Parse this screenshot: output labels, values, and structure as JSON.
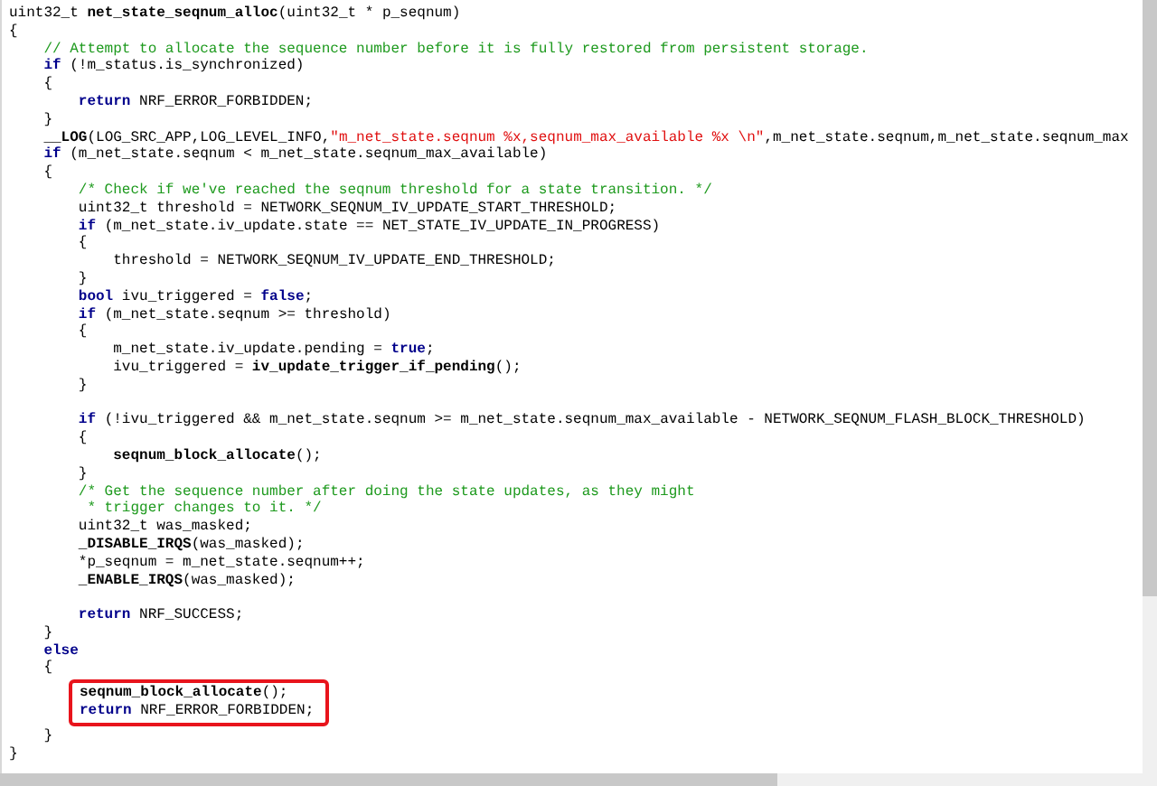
{
  "editor": {
    "lines": [
      {
        "kind": "code",
        "tokens": [
          {
            "kind": "plain",
            "text": "uint32_t "
          },
          {
            "kind": "function",
            "text": "net_state_seqnum_alloc"
          },
          {
            "kind": "plain",
            "text": "(uint32_t * p_seqnum)"
          }
        ]
      },
      {
        "kind": "code",
        "tokens": [
          {
            "kind": "plain",
            "text": "{"
          }
        ]
      },
      {
        "kind": "code",
        "tokens": [
          {
            "kind": "comment",
            "text": "    // Attempt to allocate the sequence number before it is fully restored from persistent storage."
          }
        ]
      },
      {
        "kind": "code",
        "tokens": [
          {
            "kind": "keyword",
            "text": "    if"
          },
          {
            "kind": "plain",
            "text": " (!m_status.is_synchronized)"
          }
        ]
      },
      {
        "kind": "code",
        "tokens": [
          {
            "kind": "plain",
            "text": "    {"
          }
        ]
      },
      {
        "kind": "code",
        "tokens": [
          {
            "kind": "keyword",
            "text": "        return"
          },
          {
            "kind": "plain",
            "text": " NRF_ERROR_FORBIDDEN;"
          }
        ]
      },
      {
        "kind": "code",
        "tokens": [
          {
            "kind": "plain",
            "text": "    }"
          }
        ]
      },
      {
        "kind": "code",
        "tokens": [
          {
            "kind": "function",
            "text": "    __LOG"
          },
          {
            "kind": "plain",
            "text": "(LOG_SRC_APP,LOG_LEVEL_INFO,"
          },
          {
            "kind": "string",
            "text": "\"m_net_state.seqnum %x,seqnum_max_available %x \\n\""
          },
          {
            "kind": "plain",
            "text": ",m_net_state.seqnum,m_net_state.seqnum_max"
          }
        ]
      },
      {
        "kind": "code",
        "tokens": [
          {
            "kind": "keyword",
            "text": "    if"
          },
          {
            "kind": "plain",
            "text": " (m_net_state.seqnum < m_net_state.seqnum_max_available)"
          }
        ]
      },
      {
        "kind": "code",
        "tokens": [
          {
            "kind": "plain",
            "text": "    {"
          }
        ]
      },
      {
        "kind": "code",
        "tokens": [
          {
            "kind": "comment",
            "text": "        /* Check if we've reached the seqnum threshold for a state transition. */"
          }
        ]
      },
      {
        "kind": "code",
        "tokens": [
          {
            "kind": "plain",
            "text": "        uint32_t threshold = NETWORK_SEQNUM_IV_UPDATE_START_THRESHOLD;"
          }
        ]
      },
      {
        "kind": "code",
        "tokens": [
          {
            "kind": "keyword",
            "text": "        if"
          },
          {
            "kind": "plain",
            "text": " (m_net_state.iv_update.state == NET_STATE_IV_UPDATE_IN_PROGRESS)"
          }
        ]
      },
      {
        "kind": "code",
        "tokens": [
          {
            "kind": "plain",
            "text": "        {"
          }
        ]
      },
      {
        "kind": "code",
        "tokens": [
          {
            "kind": "plain",
            "text": "            threshold = NETWORK_SEQNUM_IV_UPDATE_END_THRESHOLD;"
          }
        ]
      },
      {
        "kind": "code",
        "tokens": [
          {
            "kind": "plain",
            "text": "        }"
          }
        ]
      },
      {
        "kind": "code",
        "tokens": [
          {
            "kind": "keyword",
            "text": "        bool"
          },
          {
            "kind": "plain",
            "text": " ivu_triggered = "
          },
          {
            "kind": "keyword",
            "text": "false"
          },
          {
            "kind": "plain",
            "text": ";"
          }
        ]
      },
      {
        "kind": "code",
        "tokens": [
          {
            "kind": "keyword",
            "text": "        if"
          },
          {
            "kind": "plain",
            "text": " (m_net_state.seqnum >= threshold)"
          }
        ]
      },
      {
        "kind": "code",
        "tokens": [
          {
            "kind": "plain",
            "text": "        {"
          }
        ]
      },
      {
        "kind": "code",
        "tokens": [
          {
            "kind": "plain",
            "text": "            m_net_state.iv_update.pending = "
          },
          {
            "kind": "keyword",
            "text": "true"
          },
          {
            "kind": "plain",
            "text": ";"
          }
        ]
      },
      {
        "kind": "code",
        "tokens": [
          {
            "kind": "plain",
            "text": "            ivu_triggered = "
          },
          {
            "kind": "function",
            "text": "iv_update_trigger_if_pending"
          },
          {
            "kind": "plain",
            "text": "();"
          }
        ]
      },
      {
        "kind": "code",
        "tokens": [
          {
            "kind": "plain",
            "text": "        }"
          }
        ]
      },
      {
        "kind": "blank"
      },
      {
        "kind": "code",
        "tokens": [
          {
            "kind": "keyword",
            "text": "        if"
          },
          {
            "kind": "plain",
            "text": " (!ivu_triggered && m_net_state.seqnum >= m_net_state.seqnum_max_available - NETWORK_SEQNUM_FLASH_BLOCK_THRESHOLD)"
          }
        ]
      },
      {
        "kind": "code",
        "tokens": [
          {
            "kind": "plain",
            "text": "        {"
          }
        ]
      },
      {
        "kind": "code",
        "tokens": [
          {
            "kind": "function",
            "text": "            seqnum_block_allocate"
          },
          {
            "kind": "plain",
            "text": "();"
          }
        ]
      },
      {
        "kind": "code",
        "tokens": [
          {
            "kind": "plain",
            "text": "        }"
          }
        ]
      },
      {
        "kind": "code",
        "tokens": [
          {
            "kind": "comment",
            "text": "        /* Get the sequence number after doing the state updates, as they might"
          }
        ]
      },
      {
        "kind": "code",
        "tokens": [
          {
            "kind": "comment",
            "text": "         * trigger changes to it. */"
          }
        ]
      },
      {
        "kind": "code",
        "tokens": [
          {
            "kind": "plain",
            "text": "        uint32_t was_masked;"
          }
        ]
      },
      {
        "kind": "code",
        "tokens": [
          {
            "kind": "function",
            "text": "        _DISABLE_IRQS"
          },
          {
            "kind": "plain",
            "text": "(was_masked);"
          }
        ]
      },
      {
        "kind": "code",
        "tokens": [
          {
            "kind": "plain",
            "text": "        *p_seqnum = m_net_state.seqnum++;"
          }
        ]
      },
      {
        "kind": "code",
        "tokens": [
          {
            "kind": "function",
            "text": "        _ENABLE_IRQS"
          },
          {
            "kind": "plain",
            "text": "(was_masked);"
          }
        ]
      },
      {
        "kind": "blank"
      },
      {
        "kind": "code",
        "tokens": [
          {
            "kind": "keyword",
            "text": "        return"
          },
          {
            "kind": "plain",
            "text": " NRF_SUCCESS;"
          }
        ]
      },
      {
        "kind": "code",
        "tokens": [
          {
            "kind": "plain",
            "text": "    }"
          }
        ]
      },
      {
        "kind": "code",
        "tokens": [
          {
            "kind": "keyword",
            "text": "    else"
          }
        ]
      },
      {
        "kind": "code",
        "tokens": [
          {
            "kind": "plain",
            "text": "    {"
          }
        ]
      },
      {
        "kind": "highlight",
        "lines": [
          {
            "tokens": [
              {
                "kind": "function",
                "text": "seqnum_block_allocate"
              },
              {
                "kind": "plain",
                "text": "();"
              }
            ]
          },
          {
            "tokens": [
              {
                "kind": "keyword",
                "text": "return"
              },
              {
                "kind": "plain",
                "text": " NRF_ERROR_FORBIDDEN;"
              }
            ]
          }
        ]
      },
      {
        "kind": "code",
        "tokens": [
          {
            "kind": "plain",
            "text": "    }"
          }
        ]
      },
      {
        "kind": "code",
        "tokens": [
          {
            "kind": "plain",
            "text": "}"
          }
        ]
      }
    ]
  }
}
